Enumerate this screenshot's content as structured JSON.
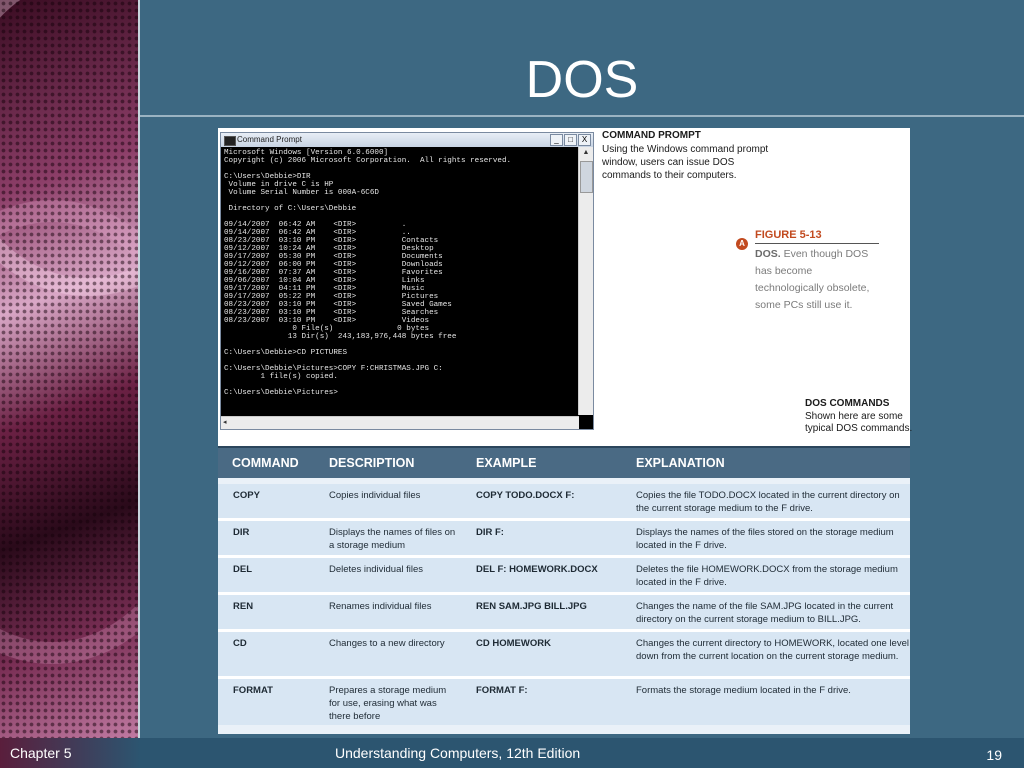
{
  "slide": {
    "title": "DOS"
  },
  "cmd_window": {
    "title": "Command Prompt",
    "btn_min": "_",
    "btn_max": "□",
    "btn_close": "X",
    "content": "Microsoft Windows [Version 6.0.6000]\nCopyright (c) 2006 Microsoft Corporation.  All rights reserved.\n\nC:\\Users\\Debbie>DIR\n Volume in drive C is HP\n Volume Serial Number is 000A-6C6D\n\n Directory of C:\\Users\\Debbie\n\n09/14/2007  06:42 AM    <DIR>          .\n09/14/2007  06:42 AM    <DIR>          ..\n08/23/2007  03:10 PM    <DIR>          Contacts\n09/12/2007  10:24 AM    <DIR>          Desktop\n09/17/2007  05:30 PM    <DIR>          Documents\n09/12/2007  06:00 PM    <DIR>          Downloads\n09/16/2007  07:37 AM    <DIR>          Favorites\n09/06/2007  10:04 AM    <DIR>          Links\n09/17/2007  04:11 PM    <DIR>          Music\n09/17/2007  05:22 PM    <DIR>          Pictures\n08/23/2007  03:10 PM    <DIR>          Saved Games\n08/23/2007  03:10 PM    <DIR>          Searches\n08/23/2007  03:10 PM    <DIR>          Videos\n               0 File(s)              0 bytes\n              13 Dir(s)  243,183,976,448 bytes free\n\nC:\\Users\\Debbie>CD PICTURES\n\nC:\\Users\\Debbie\\Pictures>COPY F:CHRISTMAS.JPG C:\n        1 file(s) copied.\n\nC:\\Users\\Debbie\\Pictures>"
  },
  "command_prompt": {
    "heading": "COMMAND PROMPT",
    "text": "Using the Windows command prompt window, users can issue DOS commands to their computers."
  },
  "figure": {
    "label": "FIGURE 5-13",
    "badge": "A",
    "caption_bold": "DOS.",
    "caption": " Even though DOS has become technologically obsolete, some PCs still use it."
  },
  "dos_commands": {
    "heading": "DOS COMMANDS",
    "text": "Shown here are some typical DOS commands."
  },
  "table": {
    "headers": [
      "COMMAND",
      "DESCRIPTION",
      "EXAMPLE",
      "EXPLANATION"
    ],
    "rows": [
      [
        "COPY",
        "Copies individual files",
        "COPY TODO.DOCX F:",
        "Copies the file TODO.DOCX located in the current directory on the current storage medium to the F drive."
      ],
      [
        "DIR",
        "Displays the names of files on a storage medium",
        "DIR F:",
        "Displays the names of the files stored on the storage medium located in the F drive."
      ],
      [
        "DEL",
        "Deletes individual files",
        "DEL F: HOMEWORK.DOCX",
        "Deletes the file HOMEWORK.DOCX from the storage medium located in the F drive."
      ],
      [
        "REN",
        "Renames individual files",
        "REN SAM.JPG BILL.JPG",
        "Changes the name of the file SAM.JPG located in the current directory on the current storage medium to BILL.JPG."
      ],
      [
        "CD",
        "Changes to a new directory",
        "CD HOMEWORK",
        "Changes the current directory to HOMEWORK, located one level down from the current location on the current storage medium."
      ],
      [
        "FORMAT",
        "Prepares a storage medium for use, erasing what was there before",
        "FORMAT F:",
        "Formats the storage medium located in the F drive."
      ]
    ]
  },
  "footer": {
    "left": "Chapter 5",
    "center": "Understanding Computers, 12th Edition",
    "page": "19"
  }
}
